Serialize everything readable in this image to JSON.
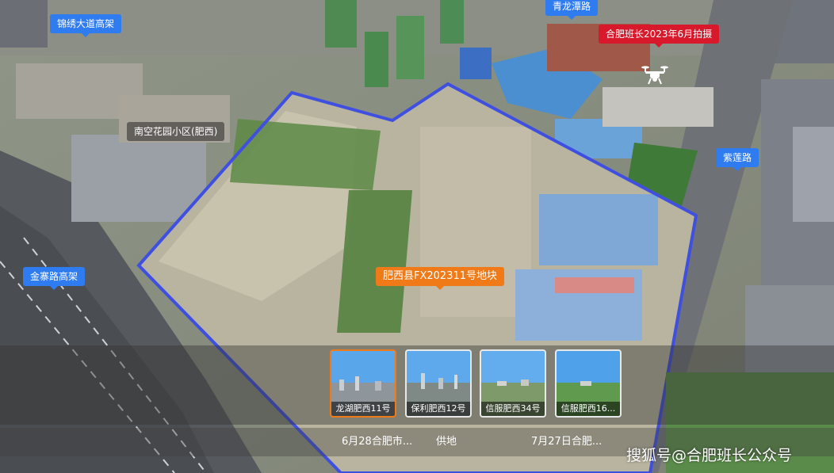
{
  "map": {
    "plot_label": "肥西县FX202311号地块",
    "photo_note": "合肥班长2023年6月拍摄",
    "labels": {
      "jinxiu_viaduct": "锦绣大道高架",
      "qinglongtan_road": "青龙潭路",
      "nanpu_community": "南空花园小区(肥西)",
      "ziliang_road": "紫莲路",
      "jinzhai_viaduct": "金寨路高架"
    },
    "colors": {
      "boundary": "#3f4fe0",
      "tag_blue": "#2f7bf0",
      "tag_red": "#d8182b",
      "tag_orange": "#f07a17"
    }
  },
  "thumbnails": [
    {
      "label": "龙湖肥西11号",
      "active": true
    },
    {
      "label": "保利肥西12号",
      "active": false
    },
    {
      "label": "信服肥西34号",
      "active": false
    },
    {
      "label": "信服肥西16...",
      "active": false
    }
  ],
  "bottom_tabs": [
    {
      "label": "6月28合肥市..."
    },
    {
      "label": "供地"
    },
    {
      "label": "7月27日合肥..."
    }
  ],
  "watermark": "搜狐号@合肥班长公众号",
  "icons": {
    "drone": "drone-icon"
  }
}
